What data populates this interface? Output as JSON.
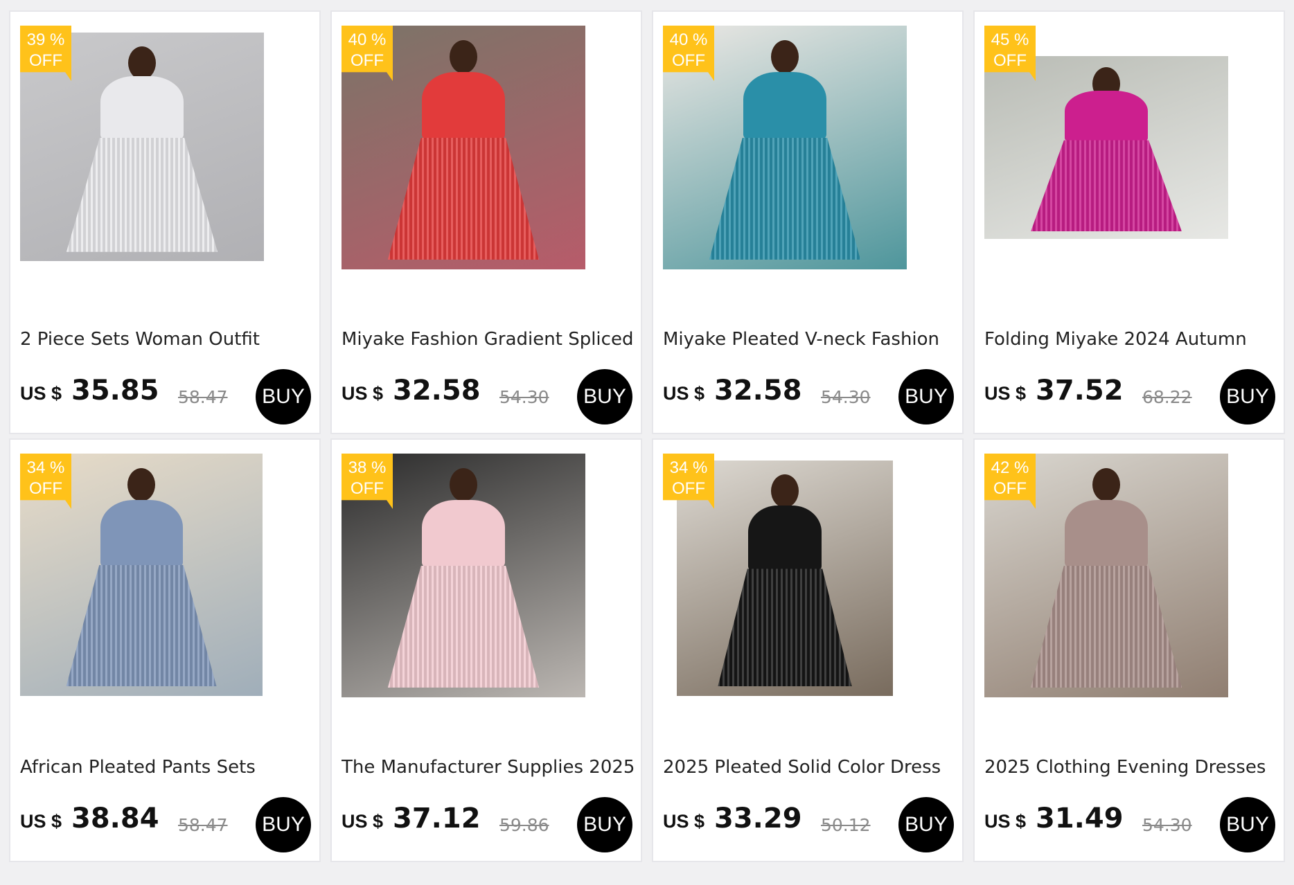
{
  "products": [
    {
      "discount_pct": "39 %",
      "discount_off": "OFF",
      "title": "2 Piece Sets Woman Outfit",
      "currency": "US $",
      "price": "35.85",
      "original_price": "58.47",
      "buy_label": "BUY",
      "image": {
        "bg": "#c9c9cb",
        "dress": "#e9e9ec",
        "accent": "#a9a9ad"
      }
    },
    {
      "discount_pct": "40 %",
      "discount_off": "OFF",
      "title": "Miyake Fashion Gradient Spliced",
      "currency": "US $",
      "price": "32.58",
      "original_price": "54.30",
      "buy_label": "BUY",
      "image": {
        "bg": "#7b7468",
        "dress": "#e23b3b",
        "accent": "#c9546a"
      }
    },
    {
      "discount_pct": "40 %",
      "discount_off": "OFF",
      "title": "Miyake Pleated V-neck Fashion",
      "currency": "US $",
      "price": "32.58",
      "original_price": "54.30",
      "buy_label": "BUY",
      "image": {
        "bg": "#ece8e4",
        "dress": "#2a8fa8",
        "accent": "#1f7d86"
      }
    },
    {
      "discount_pct": "45 %",
      "discount_off": "OFF",
      "title": "Folding Miyake 2024 Autumn",
      "currency": "US $",
      "price": "37.52",
      "original_price": "68.22",
      "buy_label": "BUY",
      "image": {
        "bg": "#b9bcb5",
        "dress": "#cc1f8e",
        "accent": "#f5f5f3"
      }
    },
    {
      "discount_pct": "34 %",
      "discount_off": "OFF",
      "title": "African Pleated Pants Sets",
      "currency": "US $",
      "price": "38.84",
      "original_price": "58.47",
      "buy_label": "BUY",
      "image": {
        "bg": "#e8dcc8",
        "dress": "#7f95b8",
        "accent": "#8aa0b5"
      }
    },
    {
      "discount_pct": "38 %",
      "discount_off": "OFF",
      "title": "The Manufacturer Supplies 2025",
      "currency": "US $",
      "price": "37.12",
      "original_price": "59.86",
      "buy_label": "BUY",
      "image": {
        "bg": "#2b2b2b",
        "dress": "#f1c9cf",
        "accent": "#e7e1db"
      }
    },
    {
      "discount_pct": "34 %",
      "discount_off": "OFF",
      "title": "2025 Pleated Solid Color Dress",
      "currency": "US $",
      "price": "33.29",
      "original_price": "50.12",
      "buy_label": "BUY",
      "image": {
        "bg": "#ddd9d2",
        "dress": "#161616",
        "accent": "#5a4a3a"
      }
    },
    {
      "discount_pct": "42 %",
      "discount_off": "OFF",
      "title": "2025 Clothing Evening Dresses",
      "currency": "US $",
      "price": "31.49",
      "original_price": "54.30",
      "buy_label": "BUY",
      "image": {
        "bg": "#d9d6cf",
        "dress": "#a88f8a",
        "accent": "#7a6455"
      }
    }
  ]
}
